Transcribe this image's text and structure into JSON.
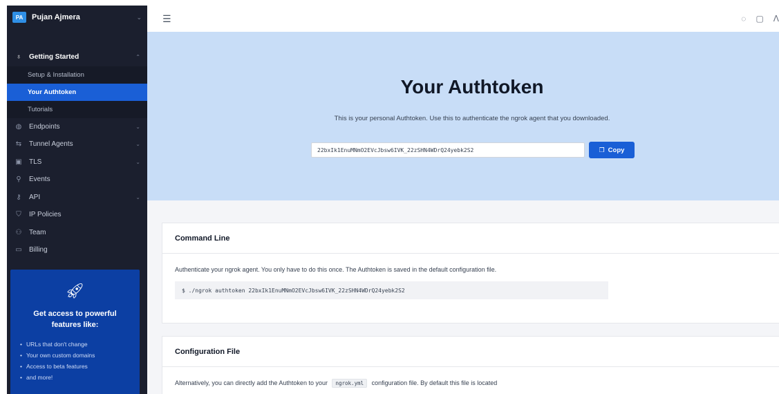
{
  "org": {
    "initials": "PA",
    "name": "Pujan Ajmera"
  },
  "sidebar": {
    "section": {
      "label": "Getting Started",
      "icon": "rocket-icon"
    },
    "sub_items": [
      {
        "label": "Setup & Installation",
        "active": false
      },
      {
        "label": "Your Authtoken",
        "active": true
      },
      {
        "label": "Tutorials",
        "active": false
      }
    ],
    "items": [
      {
        "label": "Endpoints",
        "icon": "globe-icon",
        "expandable": true
      },
      {
        "label": "Tunnel Agents",
        "icon": "tunnel-icon",
        "expandable": true
      },
      {
        "label": "TLS",
        "icon": "lock-icon",
        "expandable": true
      },
      {
        "label": "Events",
        "icon": "events-icon",
        "expandable": false
      },
      {
        "label": "API",
        "icon": "key-icon",
        "expandable": true
      },
      {
        "label": "IP Policies",
        "icon": "shield-icon",
        "expandable": false
      },
      {
        "label": "Team",
        "icon": "team-icon",
        "expandable": false
      },
      {
        "label": "Billing",
        "icon": "billing-icon",
        "expandable": false
      }
    ]
  },
  "promo": {
    "title": "Get access to powerful features like:",
    "bullets": [
      "URLs that don't change",
      "Your own custom domains",
      "Access to beta features",
      "and more!"
    ]
  },
  "hero": {
    "title": "Your Authtoken",
    "description": "This is your personal Authtoken. Use this to authenticate the ngrok agent that you downloaded.",
    "token": "22bxIk1EnuMNmO2EVcJbsw6IVK_22zSHN4WDrQ24yebk2S2",
    "copy_label": "Copy"
  },
  "command_line": {
    "title": "Command Line",
    "text": "Authenticate your ngrok agent. You only have to do this once. The Authtoken is saved in the default configuration file.",
    "code": "$ ./ngrok authtoken 22bxIk1EnuMNmO2EVcJbsw6IVK_22zSHN4WDrQ24yebk2S2"
  },
  "config_file": {
    "title": "Configuration File",
    "text_before": "Alternatively, you can directly add the Authtoken to your",
    "filename": "ngrok.yml",
    "text_after": "configuration file. By default this file is located"
  },
  "colors": {
    "sidebar_bg": "#1b1f2e",
    "accent": "#1a5fd6",
    "hero_bg": "#c8ddf7",
    "promo_bg": "#0c3fa3"
  }
}
